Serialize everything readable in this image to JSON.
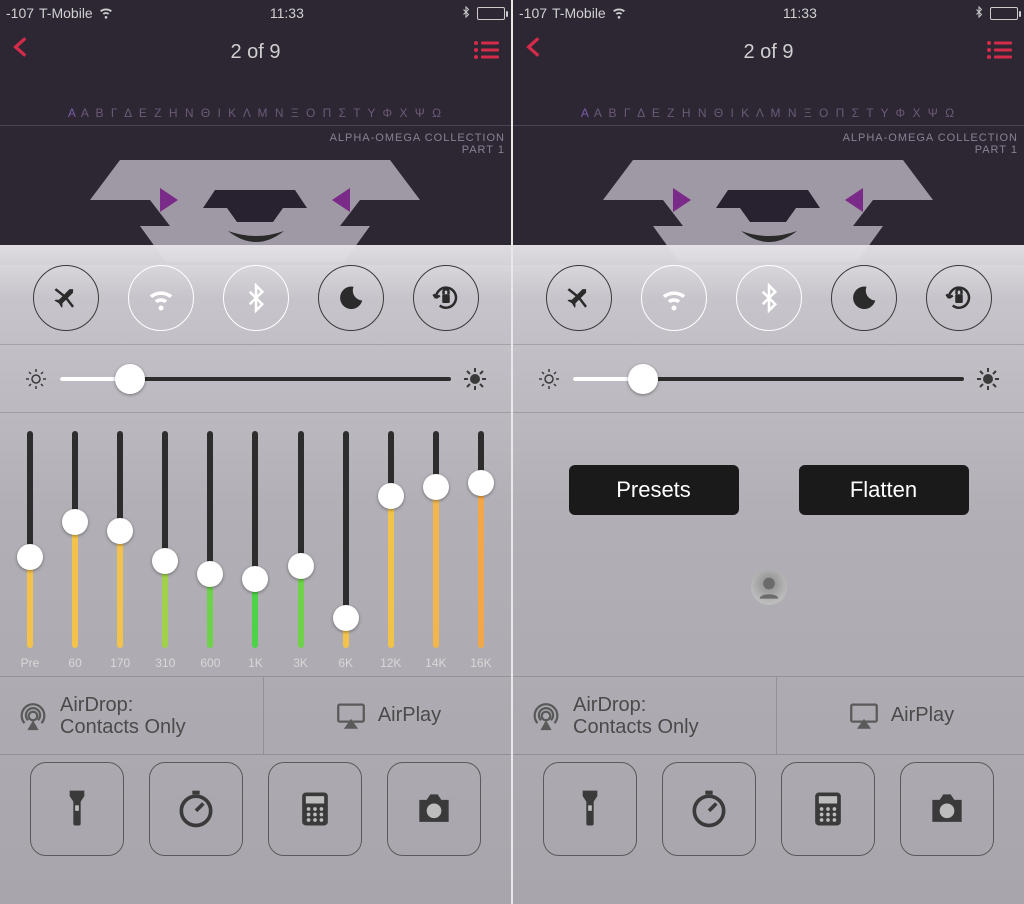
{
  "status": {
    "signal": "-107",
    "carrier": "T-Mobile",
    "time": "11:33"
  },
  "nav": {
    "title": "2 of 9"
  },
  "album": {
    "line1": "ALPHA-OMEGA COLLECTION",
    "line2": "PART 1"
  },
  "greek": "Α Β Γ Δ Ε Ζ Η Ν Θ Ι Κ Λ Μ Ν Ξ Ο Π Σ Τ Υ Φ Χ Ψ Ω",
  "brightness": {
    "percent": 18
  },
  "eq": {
    "bands": [
      {
        "label": "Pre",
        "value": 42,
        "color": "#f2c24a"
      },
      {
        "label": "60",
        "value": 58,
        "color": "#f2c24a"
      },
      {
        "label": "170",
        "value": 54,
        "color": "#f2c24a"
      },
      {
        "label": "310",
        "value": 40,
        "color": "#9fd24a"
      },
      {
        "label": "600",
        "value": 34,
        "color": "#6ed24a"
      },
      {
        "label": "1K",
        "value": 32,
        "color": "#4ed24a"
      },
      {
        "label": "3K",
        "value": 38,
        "color": "#6ed24a"
      },
      {
        "label": "6K",
        "value": 14,
        "color": "#f2c24a"
      },
      {
        "label": "12K",
        "value": 70,
        "color": "#f2c24a"
      },
      {
        "label": "14K",
        "value": 74,
        "color": "#f2b64a"
      },
      {
        "label": "16K",
        "value": 76,
        "color": "#f2a84a"
      }
    ]
  },
  "buttons": {
    "presets": "Presets",
    "flatten": "Flatten"
  },
  "air": {
    "airdrop_l1": "AirDrop:",
    "airdrop_l2": "Contacts Only",
    "airplay": "AirPlay"
  }
}
